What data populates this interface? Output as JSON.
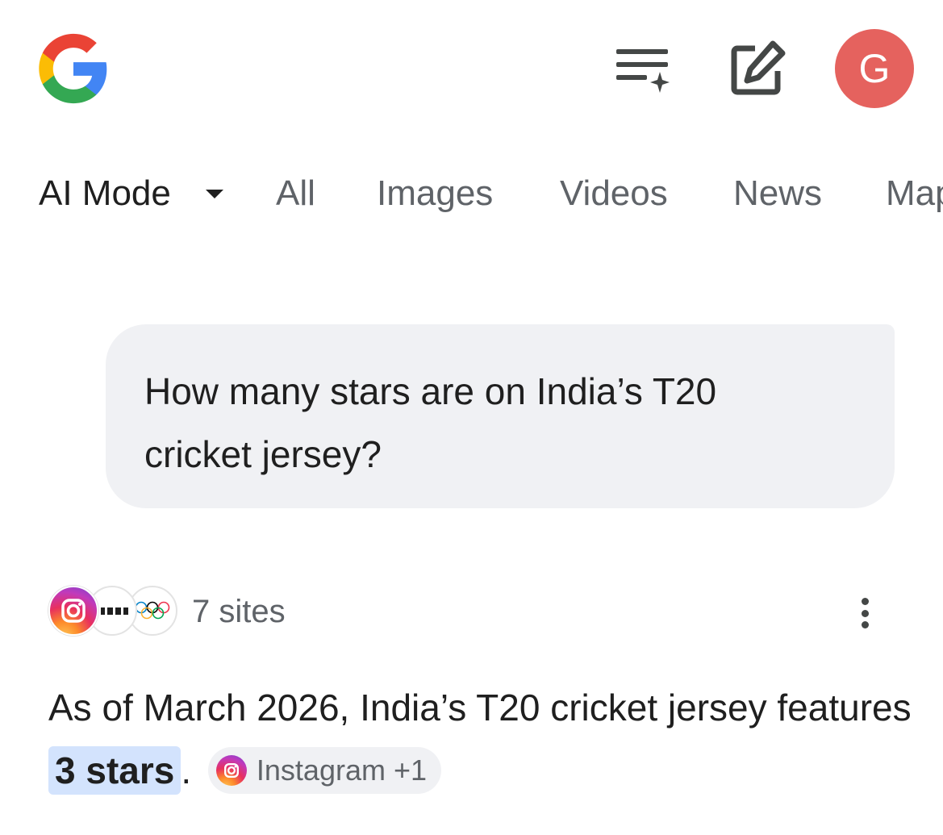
{
  "header": {
    "logo_icon": "google-g-logo",
    "history_icon": "search-history-sparkle-icon",
    "new_chat_icon": "edit-square-icon",
    "avatar_letter": "G",
    "avatar_color": "#e5625e"
  },
  "tabs": [
    {
      "label": "AI Mode",
      "active": true
    },
    {
      "label": "All"
    },
    {
      "label": "Images"
    },
    {
      "label": "Videos"
    },
    {
      "label": "News"
    },
    {
      "label": "Maps"
    }
  ],
  "query": {
    "line1": "How many stars are on India’s T20",
    "line2": "cricket jersey?"
  },
  "sources": {
    "count_label": "7 sites",
    "favicons": [
      "instagram-icon",
      "site-icon",
      "olympic-rings-icon"
    ]
  },
  "answer": {
    "text_before": "As of March 2026, India’s T20 cricket jersey features ",
    "highlight": "3 stars",
    "text_after": ".",
    "citation_label": "Instagram +1"
  },
  "colors": {
    "highlight_bg": "#d3e3fd",
    "bubble_bg": "#f0f1f4",
    "muted_text": "#5f6368"
  }
}
